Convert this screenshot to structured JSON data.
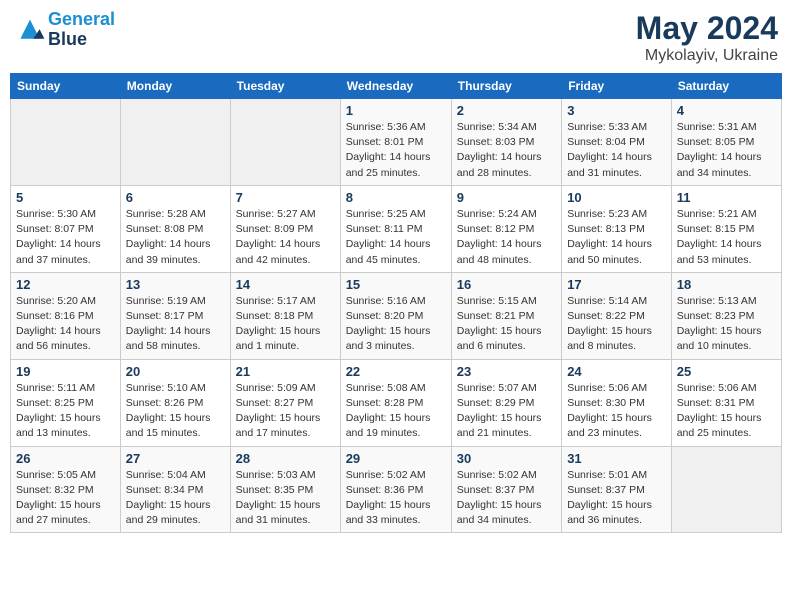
{
  "header": {
    "logo_line1": "General",
    "logo_line2": "Blue",
    "month": "May 2024",
    "location": "Mykolayiv, Ukraine"
  },
  "weekdays": [
    "Sunday",
    "Monday",
    "Tuesday",
    "Wednesday",
    "Thursday",
    "Friday",
    "Saturday"
  ],
  "weeks": [
    [
      {
        "day": "",
        "info": ""
      },
      {
        "day": "",
        "info": ""
      },
      {
        "day": "",
        "info": ""
      },
      {
        "day": "1",
        "info": "Sunrise: 5:36 AM\nSunset: 8:01 PM\nDaylight: 14 hours\nand 25 minutes."
      },
      {
        "day": "2",
        "info": "Sunrise: 5:34 AM\nSunset: 8:03 PM\nDaylight: 14 hours\nand 28 minutes."
      },
      {
        "day": "3",
        "info": "Sunrise: 5:33 AM\nSunset: 8:04 PM\nDaylight: 14 hours\nand 31 minutes."
      },
      {
        "day": "4",
        "info": "Sunrise: 5:31 AM\nSunset: 8:05 PM\nDaylight: 14 hours\nand 34 minutes."
      }
    ],
    [
      {
        "day": "5",
        "info": "Sunrise: 5:30 AM\nSunset: 8:07 PM\nDaylight: 14 hours\nand 37 minutes."
      },
      {
        "day": "6",
        "info": "Sunrise: 5:28 AM\nSunset: 8:08 PM\nDaylight: 14 hours\nand 39 minutes."
      },
      {
        "day": "7",
        "info": "Sunrise: 5:27 AM\nSunset: 8:09 PM\nDaylight: 14 hours\nand 42 minutes."
      },
      {
        "day": "8",
        "info": "Sunrise: 5:25 AM\nSunset: 8:11 PM\nDaylight: 14 hours\nand 45 minutes."
      },
      {
        "day": "9",
        "info": "Sunrise: 5:24 AM\nSunset: 8:12 PM\nDaylight: 14 hours\nand 48 minutes."
      },
      {
        "day": "10",
        "info": "Sunrise: 5:23 AM\nSunset: 8:13 PM\nDaylight: 14 hours\nand 50 minutes."
      },
      {
        "day": "11",
        "info": "Sunrise: 5:21 AM\nSunset: 8:15 PM\nDaylight: 14 hours\nand 53 minutes."
      }
    ],
    [
      {
        "day": "12",
        "info": "Sunrise: 5:20 AM\nSunset: 8:16 PM\nDaylight: 14 hours\nand 56 minutes."
      },
      {
        "day": "13",
        "info": "Sunrise: 5:19 AM\nSunset: 8:17 PM\nDaylight: 14 hours\nand 58 minutes."
      },
      {
        "day": "14",
        "info": "Sunrise: 5:17 AM\nSunset: 8:18 PM\nDaylight: 15 hours\nand 1 minute."
      },
      {
        "day": "15",
        "info": "Sunrise: 5:16 AM\nSunset: 8:20 PM\nDaylight: 15 hours\nand 3 minutes."
      },
      {
        "day": "16",
        "info": "Sunrise: 5:15 AM\nSunset: 8:21 PM\nDaylight: 15 hours\nand 6 minutes."
      },
      {
        "day": "17",
        "info": "Sunrise: 5:14 AM\nSunset: 8:22 PM\nDaylight: 15 hours\nand 8 minutes."
      },
      {
        "day": "18",
        "info": "Sunrise: 5:13 AM\nSunset: 8:23 PM\nDaylight: 15 hours\nand 10 minutes."
      }
    ],
    [
      {
        "day": "19",
        "info": "Sunrise: 5:11 AM\nSunset: 8:25 PM\nDaylight: 15 hours\nand 13 minutes."
      },
      {
        "day": "20",
        "info": "Sunrise: 5:10 AM\nSunset: 8:26 PM\nDaylight: 15 hours\nand 15 minutes."
      },
      {
        "day": "21",
        "info": "Sunrise: 5:09 AM\nSunset: 8:27 PM\nDaylight: 15 hours\nand 17 minutes."
      },
      {
        "day": "22",
        "info": "Sunrise: 5:08 AM\nSunset: 8:28 PM\nDaylight: 15 hours\nand 19 minutes."
      },
      {
        "day": "23",
        "info": "Sunrise: 5:07 AM\nSunset: 8:29 PM\nDaylight: 15 hours\nand 21 minutes."
      },
      {
        "day": "24",
        "info": "Sunrise: 5:06 AM\nSunset: 8:30 PM\nDaylight: 15 hours\nand 23 minutes."
      },
      {
        "day": "25",
        "info": "Sunrise: 5:06 AM\nSunset: 8:31 PM\nDaylight: 15 hours\nand 25 minutes."
      }
    ],
    [
      {
        "day": "26",
        "info": "Sunrise: 5:05 AM\nSunset: 8:32 PM\nDaylight: 15 hours\nand 27 minutes."
      },
      {
        "day": "27",
        "info": "Sunrise: 5:04 AM\nSunset: 8:34 PM\nDaylight: 15 hours\nand 29 minutes."
      },
      {
        "day": "28",
        "info": "Sunrise: 5:03 AM\nSunset: 8:35 PM\nDaylight: 15 hours\nand 31 minutes."
      },
      {
        "day": "29",
        "info": "Sunrise: 5:02 AM\nSunset: 8:36 PM\nDaylight: 15 hours\nand 33 minutes."
      },
      {
        "day": "30",
        "info": "Sunrise: 5:02 AM\nSunset: 8:37 PM\nDaylight: 15 hours\nand 34 minutes."
      },
      {
        "day": "31",
        "info": "Sunrise: 5:01 AM\nSunset: 8:37 PM\nDaylight: 15 hours\nand 36 minutes."
      },
      {
        "day": "",
        "info": ""
      }
    ]
  ]
}
